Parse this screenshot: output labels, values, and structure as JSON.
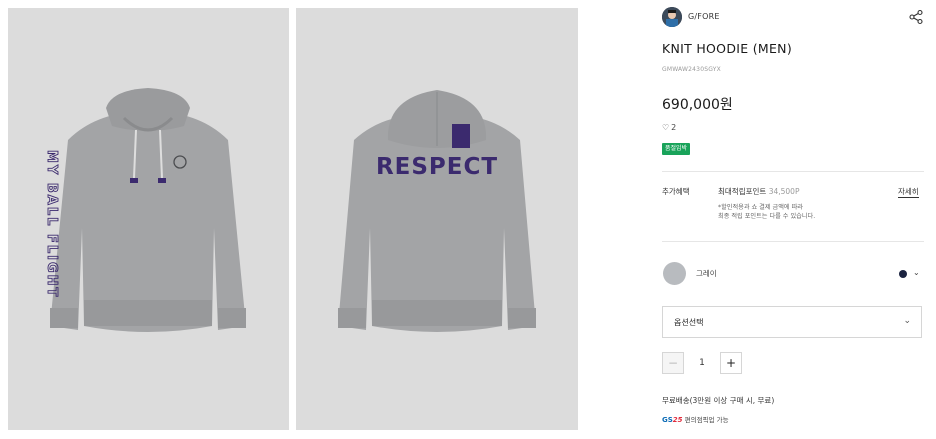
{
  "gallery": {
    "front_alt": "Knit hoodie front view",
    "front_sleeve_text": "MY BALL FLIGHT",
    "back_alt": "Knit hoodie back view",
    "back_print_text": "RESPECT"
  },
  "brand": {
    "name": "G/FORE",
    "share_icon": "share-icon"
  },
  "product": {
    "title": "KNIT HOODIE (MEN)",
    "sku": "GMWAW2430SGYX",
    "price": "690,000원",
    "likes": "2",
    "badge": "품절임박"
  },
  "benefits": {
    "label": "추가혜택",
    "points_label": "최대적립포인트",
    "points_value": "34,500P",
    "detail_link": "자세히",
    "note_line1": "*할인적용과 쇼 결제 금액에 따라",
    "note_line2": "최종 적립 포인트는 다를 수 있습니다."
  },
  "color": {
    "name": "그레이",
    "swatch_hex": "#b8bbbf",
    "option_dot_hex": "#1b2340"
  },
  "option_select": {
    "label": "옵션선택"
  },
  "quantity": {
    "minus": "−",
    "value": "1",
    "plus": "+"
  },
  "shipping": {
    "text": "무료배송(3만원 이상 구매 시, 무료)"
  },
  "gs25": {
    "logo_prefix": "GS",
    "logo_num": "25",
    "text": "편의점픽업 가능"
  },
  "colors": {
    "accent_green": "#19a35a",
    "gallery_bg": "#dcdcdc",
    "hoodie_gray": "#a3a4a6",
    "print_purple": "#3b2a6e"
  }
}
